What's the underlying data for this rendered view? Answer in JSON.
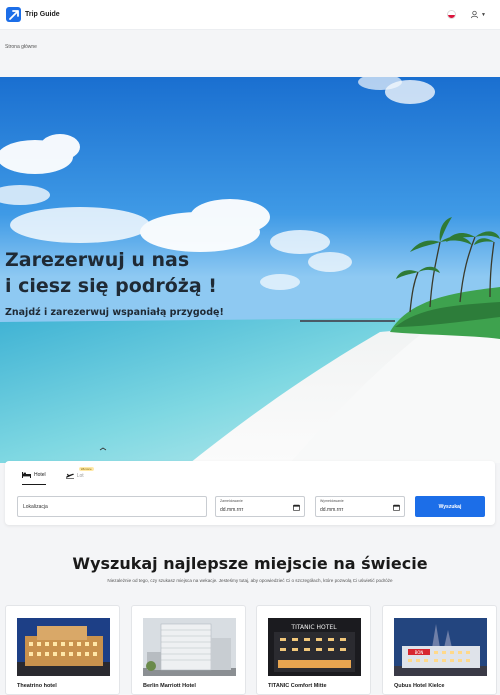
{
  "header": {
    "app_name": "Trip Guide",
    "language_flag": "pl-flag-icon",
    "user_icon": "user-icon"
  },
  "breadcrumb": {
    "current": "Strona główne"
  },
  "hero": {
    "title_line1": "Zarezerwuj u nas",
    "title_line2": "i ciesz się podróżą !",
    "subtitle": "Znajdź i zarezerwuj wspaniałą przygodę!"
  },
  "search": {
    "tabs": [
      {
        "label": "Hotel",
        "icon": "bed-icon",
        "active": true
      },
      {
        "label": "Lot",
        "icon": "plane-icon",
        "active": false,
        "badge": "Wkrótce"
      }
    ],
    "location_placeholder": "Lokalizacja",
    "checkin_label": "Zameldowanie",
    "checkin_value": "dd.mm.rrrr",
    "checkout_label": "Wymeldowanie",
    "checkout_value": "dd.mm.rrrr",
    "button_label": "Wyszukaj"
  },
  "section": {
    "title": "Wyszukaj najlepsze miejscie na świecie",
    "subtitle": "Niezależnie od tego, czy szukasz miejsca na wekacje. Jesteśmy tutaj, aby opowiedzieć Ci o szczegółach, które pozwolą Ci uświetić podróże"
  },
  "hotels": [
    {
      "name": "Theatrino hotel"
    },
    {
      "name": "Berlin Marriott Hotel"
    },
    {
      "name": "TITANIC Comfort Mitte"
    },
    {
      "name": "Qubus Hotel Kielce"
    }
  ],
  "colors": {
    "accent": "#1c6ee8",
    "sky": "#1f86d9",
    "sea": "#7ad6df",
    "sand": "#f6f7f7"
  }
}
